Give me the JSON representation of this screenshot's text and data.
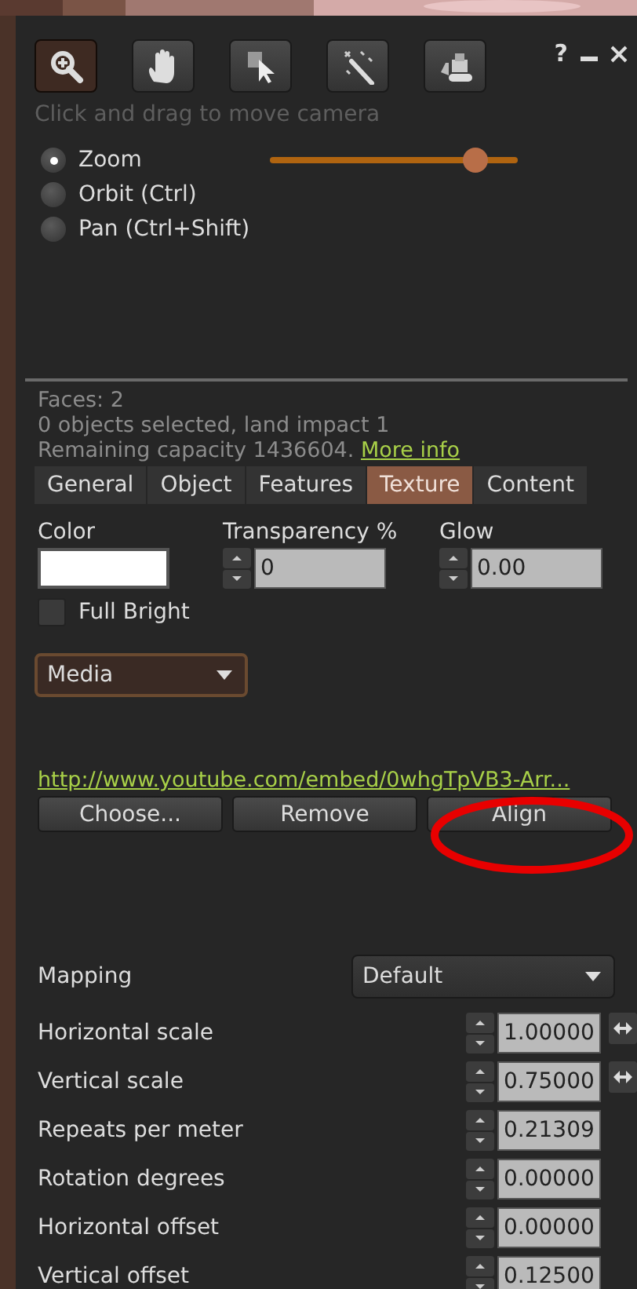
{
  "toolbar": {
    "tools": [
      {
        "kind": "zoom",
        "selected": true
      },
      {
        "kind": "grab",
        "selected": false
      },
      {
        "kind": "select",
        "selected": false
      },
      {
        "kind": "wand",
        "selected": false
      },
      {
        "kind": "bulldozer",
        "selected": false
      }
    ],
    "help": "?"
  },
  "hint": "Click and drag to move camera",
  "camera_modes": [
    {
      "label": "Zoom",
      "selected": true
    },
    {
      "label": "Orbit (Ctrl)",
      "selected": false
    },
    {
      "label": "Pan (Ctrl+Shift)",
      "selected": false
    }
  ],
  "zoom_slider": {
    "level": 0.83
  },
  "info": {
    "faces": "Faces: 2",
    "selection": "0 objects selected, land impact 1",
    "capacity": "Remaining capacity 1436604.",
    "link": "More info"
  },
  "tabs": [
    {
      "label": "General",
      "selected": false
    },
    {
      "label": "Object",
      "selected": false
    },
    {
      "label": "Features",
      "selected": false
    },
    {
      "label": "Texture",
      "selected": true
    },
    {
      "label": "Content",
      "selected": false
    }
  ],
  "color": {
    "label": "Color"
  },
  "transparency": {
    "label": "Transparency %",
    "value": "0"
  },
  "glow": {
    "label": "Glow",
    "value": "0.00"
  },
  "full_bright": {
    "label": "Full Bright",
    "checked": false
  },
  "media_dropdown": {
    "value": "Media"
  },
  "media_url": "http://www.youtube.com/embed/0whgTpVB3-Arr...",
  "media_buttons": [
    "Choose...",
    "Remove",
    "Align"
  ],
  "mapping": {
    "label": "Mapping",
    "value": "Default"
  },
  "params": [
    {
      "label": "Horizontal scale",
      "value": "1.00000",
      "linked": true
    },
    {
      "label": "Vertical scale",
      "value": "0.75000",
      "linked": true
    },
    {
      "label": "Repeats per meter",
      "value": "0.21309",
      "linked": false
    },
    {
      "label": "Rotation degrees",
      "value": "0.00000",
      "linked": false
    },
    {
      "label": "Horizontal offset",
      "value": "0.00000",
      "linked": false
    },
    {
      "label": "Vertical offset",
      "value": "0.12500",
      "linked": false
    }
  ]
}
